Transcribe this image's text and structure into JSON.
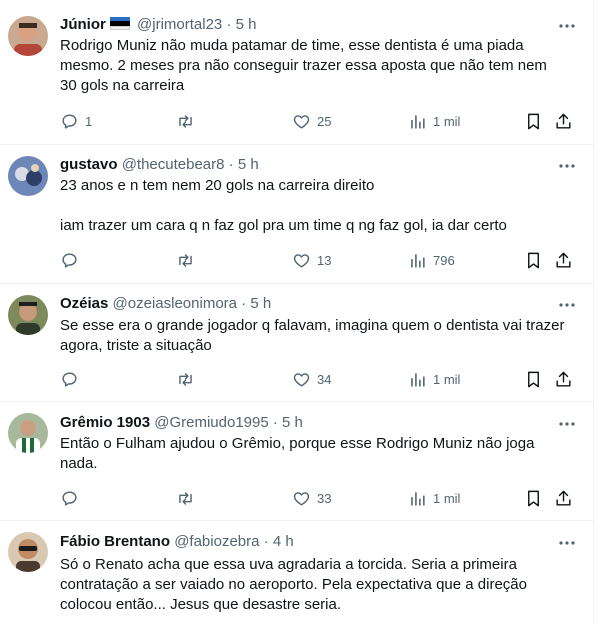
{
  "tweets": [
    {
      "name": "Júnior",
      "flag": "estonia",
      "handle": "@jrimortal23",
      "time": "5 h",
      "text": "Rodrigo Muniz não muda patamar de time, esse dentista é uma piada\nmesmo. 2 meses pra não conseguir trazer essa aposta que não tem nem\n30 gols na carreira",
      "replies": "1",
      "retweets": "",
      "likes": "25",
      "views": "1 mil",
      "avatar_color": "#b5473a"
    },
    {
      "name": "gustavo",
      "handle": "@thecutebear8",
      "time": "5 h",
      "text": "23 anos e n tem nem 20 gols na carreira direito\n\niam trazer um cara q n faz gol pra um time q ng faz gol, ia dar certo",
      "replies": "",
      "retweets": "",
      "likes": "13",
      "views": "796",
      "avatar_color": "#4f6fa8"
    },
    {
      "name": "Ozéias",
      "handle": "@ozeiasleonimora",
      "time": "5 h",
      "text": "Se esse era o grande jogador q falavam, imagina quem o dentista vai trazer\nagora, triste a situação",
      "replies": "",
      "retweets": "",
      "likes": "34",
      "views": "1 mil",
      "avatar_color": "#5b6b3d"
    },
    {
      "name": "Grêmio 1903",
      "handle": "@Gremiudo1995",
      "time": "5 h",
      "text": "Então o Fulham ajudou o Grêmio, porque esse Rodrigo Muniz não joga\nnada.",
      "replies": "",
      "retweets": "",
      "likes": "33",
      "views": "1 mil",
      "avatar_color": "#3f7a4a"
    },
    {
      "name": "Fábio Brentano",
      "handle": "@fabiozebra",
      "time": "4 h",
      "text": "Só o Renato acha que essa uva agradaria a torcida. Seria a primeira\ncontratação a ser vaiado no aeroporto. Pela expectativa que a direção\ncolocou então... Jesus que desastre seria.",
      "avatar_color": "#8a6a4f"
    }
  ],
  "icons": {
    "reply": "reply-icon",
    "retweet": "retweet-icon",
    "like": "heart-icon",
    "views": "views-icon",
    "bookmark": "bookmark-icon",
    "share": "share-icon",
    "more": "more-icon"
  },
  "colors": {
    "secondary_text": "#536471",
    "primary_text": "#0f1419",
    "divider": "#eff3f4"
  }
}
